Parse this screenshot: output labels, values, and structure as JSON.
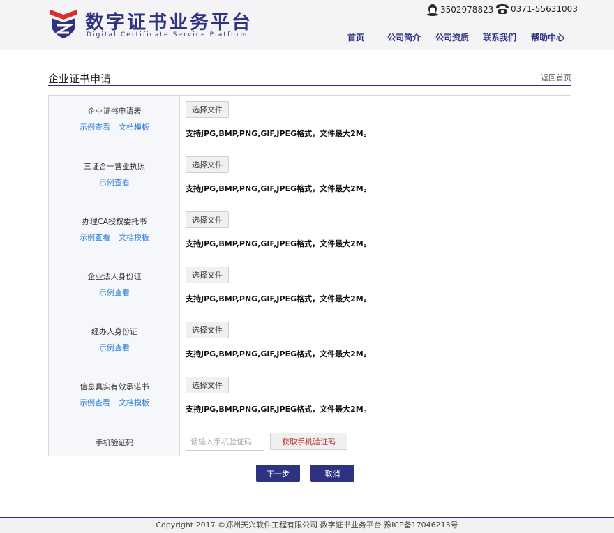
{
  "header": {
    "logo_cn": "数字证书业务平台",
    "logo_en": "Digital Certificate Service Platform",
    "qq": "3502978823",
    "phone": "0371-55631003",
    "nav": [
      "首页",
      "公司简介",
      "公司资质",
      "联系我们",
      "帮助中心"
    ]
  },
  "main": {
    "title": "企业证书申请",
    "back_label": "返回首页"
  },
  "form": {
    "rows": [
      {
        "label": "企业证书申请表",
        "links": [
          "示例查看",
          "文档模板"
        ],
        "button": "选择文件",
        "hint": "支持JPG,BMP,PNG,GIF,JPEG格式，文件最大2M。"
      },
      {
        "label": "三证合一营业执照",
        "links": [
          "示例查看"
        ],
        "button": "选择文件",
        "hint": "支持JPG,BMP,PNG,GIF,JPEG格式，文件最大2M。"
      },
      {
        "label": "办理CA授权委托书",
        "links": [
          "示例查看",
          "文档模板"
        ],
        "button": "选择文件",
        "hint": "支持JPG,BMP,PNG,GIF,JPEG格式，文件最大2M。"
      },
      {
        "label": "企业法人身份证",
        "links": [
          "示例查看"
        ],
        "button": "选择文件",
        "hint": "支持JPG,BMP,PNG,GIF,JPEG格式，文件最大2M。"
      },
      {
        "label": "经办人身份证",
        "links": [
          "示例查看"
        ],
        "button": "选择文件",
        "hint": "支持JPG,BMP,PNG,GIF,JPEG格式，文件最大2M。"
      },
      {
        "label": "信息真实有效承诺书",
        "links": [
          "示例查看",
          "文档模板"
        ],
        "button": "选择文件",
        "hint": "支持JPG,BMP,PNG,GIF,JPEG格式，文件最大2M。"
      }
    ],
    "sms": {
      "label": "手机验证码",
      "placeholder": "请输入手机验证码",
      "value": "",
      "button": "获取手机验证码"
    }
  },
  "actions": {
    "next": "下一步",
    "cancel": "取消"
  },
  "footer": {
    "text": "Copyright 2017 ©郑州天兴软件工程有限公司 数字证书业务平台 豫ICP备17046213号"
  },
  "colors": {
    "brand": "#2e3282",
    "link": "#2a7dd6",
    "accent_red": "#c0282e",
    "shield_red": "#d8302f"
  },
  "icons": {
    "logo": "shield-logo-icon",
    "qq": "qq-penguin-icon",
    "phone": "telephone-icon"
  }
}
